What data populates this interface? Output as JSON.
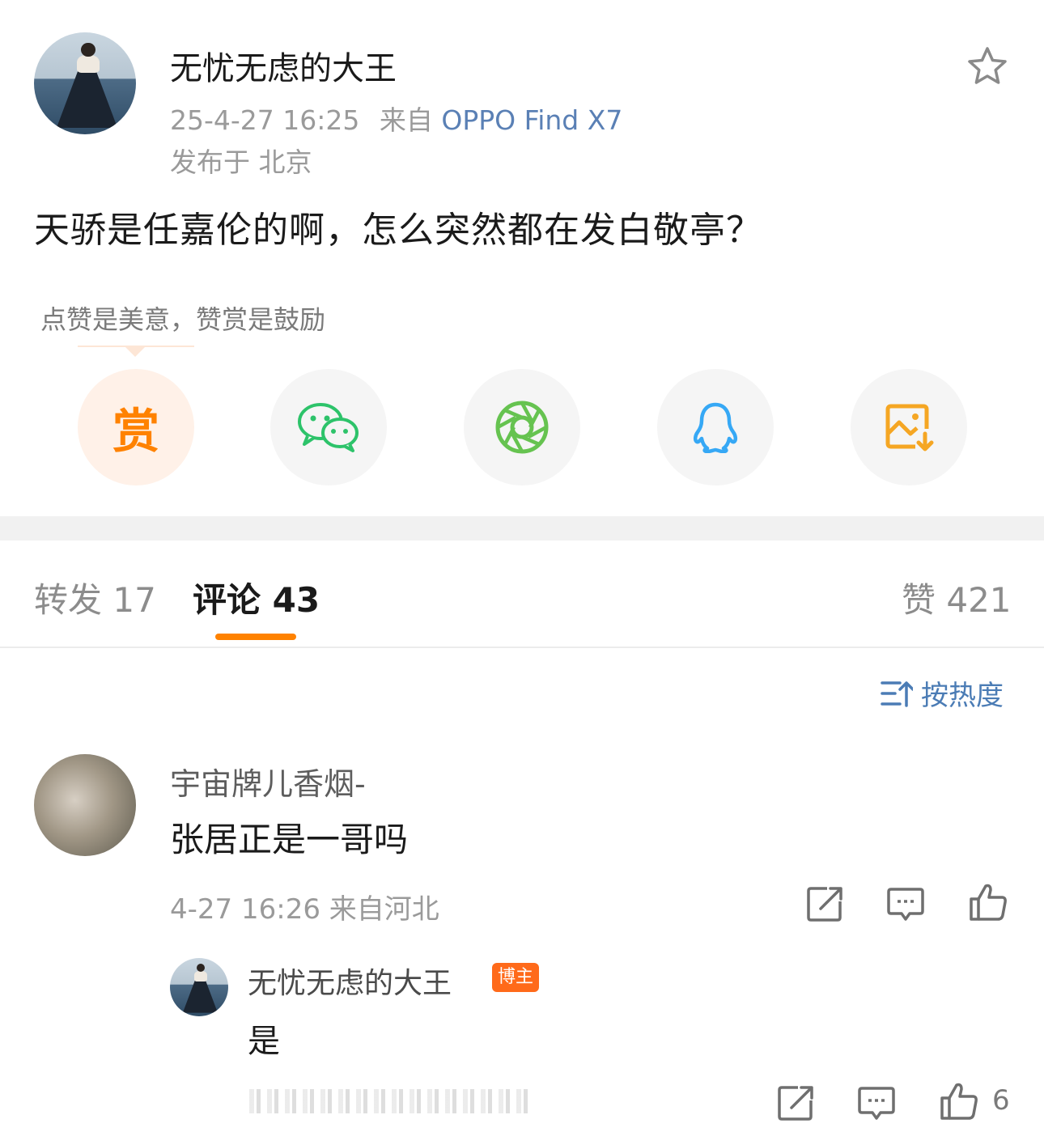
{
  "post": {
    "author": "无忧无虑的大王",
    "timestamp": "25-4-27 16:25",
    "source_prefix": "来自",
    "device": "OPPO Find X7",
    "location": "发布于 北京",
    "text": "天骄是任嘉伦的啊，怎么突然都在发白敬亭？"
  },
  "reward": {
    "tip": "点赞是美意，赞赏是鼓励",
    "button_label": "赏"
  },
  "share_icons": [
    "reward-icon",
    "wechat-icon",
    "moments-icon",
    "qq-icon",
    "save-image-icon"
  ],
  "tabs": {
    "repost": "转发 17",
    "comments": "评论 43",
    "likes": "赞 421"
  },
  "sort": {
    "label": "按热度"
  },
  "comment": {
    "name": "宇宙牌儿香烟-",
    "text": "张居正是一哥吗",
    "meta": "4-27 16:26 来自河北"
  },
  "reply": {
    "name": "无忧无虑的大王",
    "badge": "博主",
    "text": "是",
    "like_count": "6"
  },
  "colors": {
    "accent": "#ff8200",
    "link": "#5a80b5",
    "sort": "#4b7cb5",
    "wechat": "#2dc36a",
    "moments": "#66c350",
    "qq": "#36a8f5",
    "save": "#f5a623"
  }
}
